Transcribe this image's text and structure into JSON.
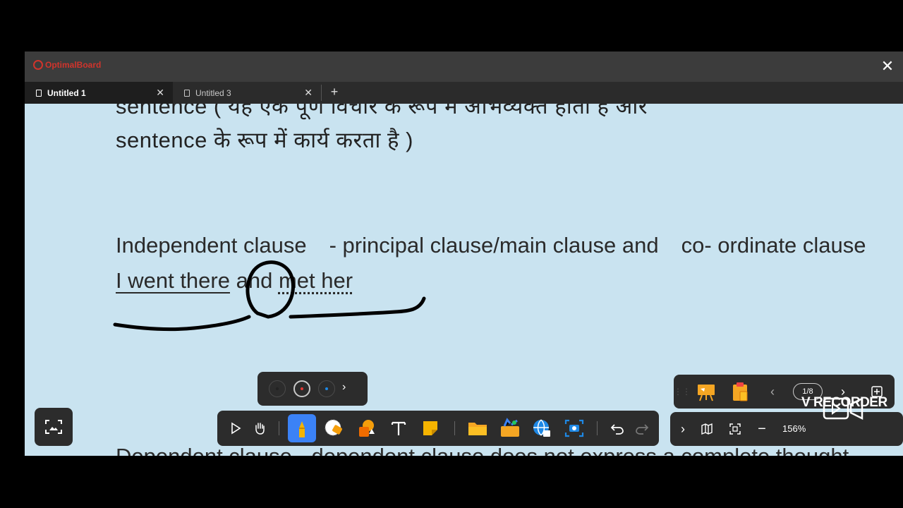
{
  "app": {
    "logo_text": "OptimalBoard",
    "close_icon": "close-icon"
  },
  "tabs": [
    {
      "label": "Untitled 1",
      "active": true
    },
    {
      "label": "Untitled 3",
      "active": false
    }
  ],
  "tab_close": "✕",
  "add_tab": "+",
  "content": {
    "line1": "sentence  ( यह एक पूर्ण विचार के रूप में अभिव्यक्त होता है और",
    "line2": "sentence  के रूप में कार्य करता है )",
    "line3_a": "Independent clause",
    "line3_b": "- principal clause/main clause and",
    "line3_c": "co- ordinate clause",
    "line4_a": "I went there",
    "line4_b": " and ",
    "line4_c": "met her",
    "line5": "Dependent clause - dependent clause does not express a complete thought"
  },
  "color_picker": {
    "colors": [
      "#222222",
      "#e53935",
      "#1e88e5"
    ],
    "selected": 1,
    "more_icon": "chevron-right-icon"
  },
  "toolbar": {
    "tools": [
      "select-icon",
      "hand-icon",
      "highlighter-icon",
      "eraser-icon",
      "shapes-icon",
      "text-icon",
      "sticky-note-icon",
      "folder-icon",
      "toolbox-icon",
      "browser-icon",
      "screenshot-icon",
      "undo-icon",
      "redo-icon"
    ],
    "active_tool": "highlighter-icon"
  },
  "pages": {
    "current": "1/8",
    "prev_icon": "chevron-left-icon",
    "next_icon": "chevron-right-icon"
  },
  "zoom": {
    "value": "156%"
  },
  "watermark": {
    "text": "V RECORDER"
  }
}
